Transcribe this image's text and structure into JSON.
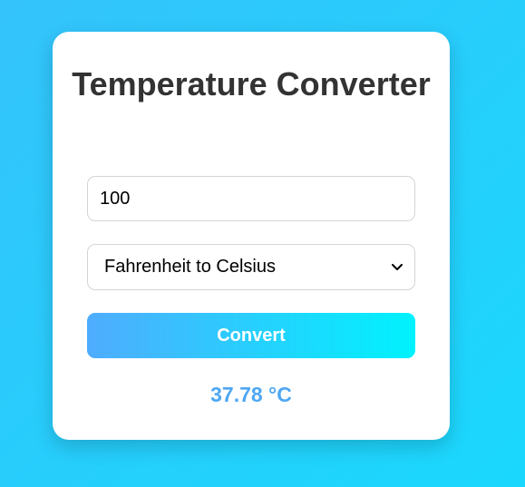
{
  "converter": {
    "title": "Temperature Converter",
    "input_value": "100",
    "conversion_selected": "Fahrenheit to Celsius",
    "convert_label": "Convert",
    "result": "37.78 °C"
  },
  "colors": {
    "background_start": "#34c3fb",
    "background_end": "#1ad8fd",
    "button_start": "#4facfe",
    "button_end": "#00f2fe",
    "title": "#333333",
    "result": "#4ea7f3"
  },
  "icons": {
    "select_arrow": "chevron-down-icon"
  }
}
